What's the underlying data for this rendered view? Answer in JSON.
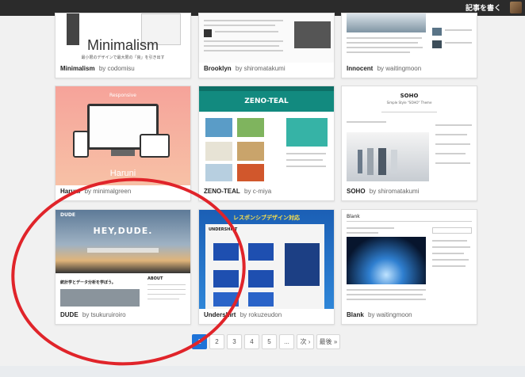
{
  "topbar": {
    "write_label": "記事を書く"
  },
  "themes": [
    {
      "name": "Minimalism",
      "by": "by codomisu",
      "thumb_text": "Minimalism",
      "thumb_sub": "最小限のデザインで最大限の「良」を引き出す"
    },
    {
      "name": "Brooklyn",
      "by": "by shiromatakumi"
    },
    {
      "name": "Innocent",
      "by": "by waitingmoon"
    },
    {
      "name": "Haruni",
      "by": "by minimalgreen",
      "thumb_text": "Haruni",
      "thumb_tag": "Responsive"
    },
    {
      "name": "ZENO-TEAL",
      "by": "by c-miya",
      "thumb_text": "ZENO-TEAL"
    },
    {
      "name": "SOHO",
      "by": "by shiromatakumi",
      "thumb_text": "SOHO",
      "thumb_sub": "Simple Style \"SOHO\" Theme"
    },
    {
      "name": "DUDE",
      "by": "by tsukuruiroiro",
      "thumb_text": "HEY,DUDE.",
      "thumb_logo": "DUDE",
      "thumb_post": "統計学とデータ分析を学ぼう。",
      "thumb_side": "ABOUT"
    },
    {
      "name": "Undershirt",
      "by": "by rokuzeudon",
      "thumb_text": "レスポンシブデザイン対応",
      "thumb_sub": "UNDERSHIRT"
    },
    {
      "name": "Blank",
      "by": "by waitingmoon",
      "thumb_text": "Blank"
    }
  ],
  "pagination": {
    "pages": [
      "1",
      "2",
      "3",
      "4",
      "5",
      "...",
      "次 ›",
      "最後 »"
    ],
    "current": "1"
  }
}
